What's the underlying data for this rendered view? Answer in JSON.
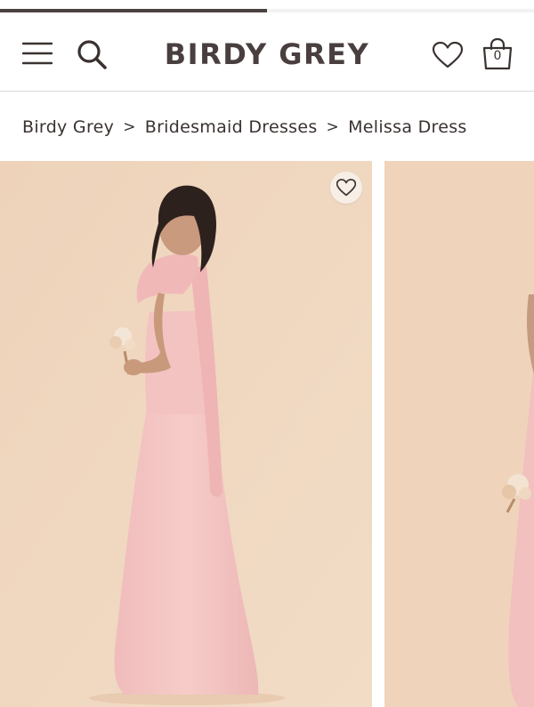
{
  "header": {
    "brand": "BIRDY GREY",
    "cart_count": "0",
    "icons": {
      "menu": "hamburger-menu-icon",
      "search": "search-icon",
      "wishlist": "heart-outline-icon",
      "cart": "shopping-bag-icon"
    }
  },
  "page_progress": 0.5,
  "breadcrumb": {
    "items": [
      "Birdy Grey",
      "Bridesmaid Dresses",
      "Melissa Dress"
    ],
    "separator": ">"
  },
  "gallery": {
    "favorite_icon": "heart-outline-icon"
  },
  "colors": {
    "brand_text": "#4a3f3f",
    "photo_background": "#efd5bc",
    "dress_pink": "#f4c4c2",
    "progress": "#4b4141"
  }
}
